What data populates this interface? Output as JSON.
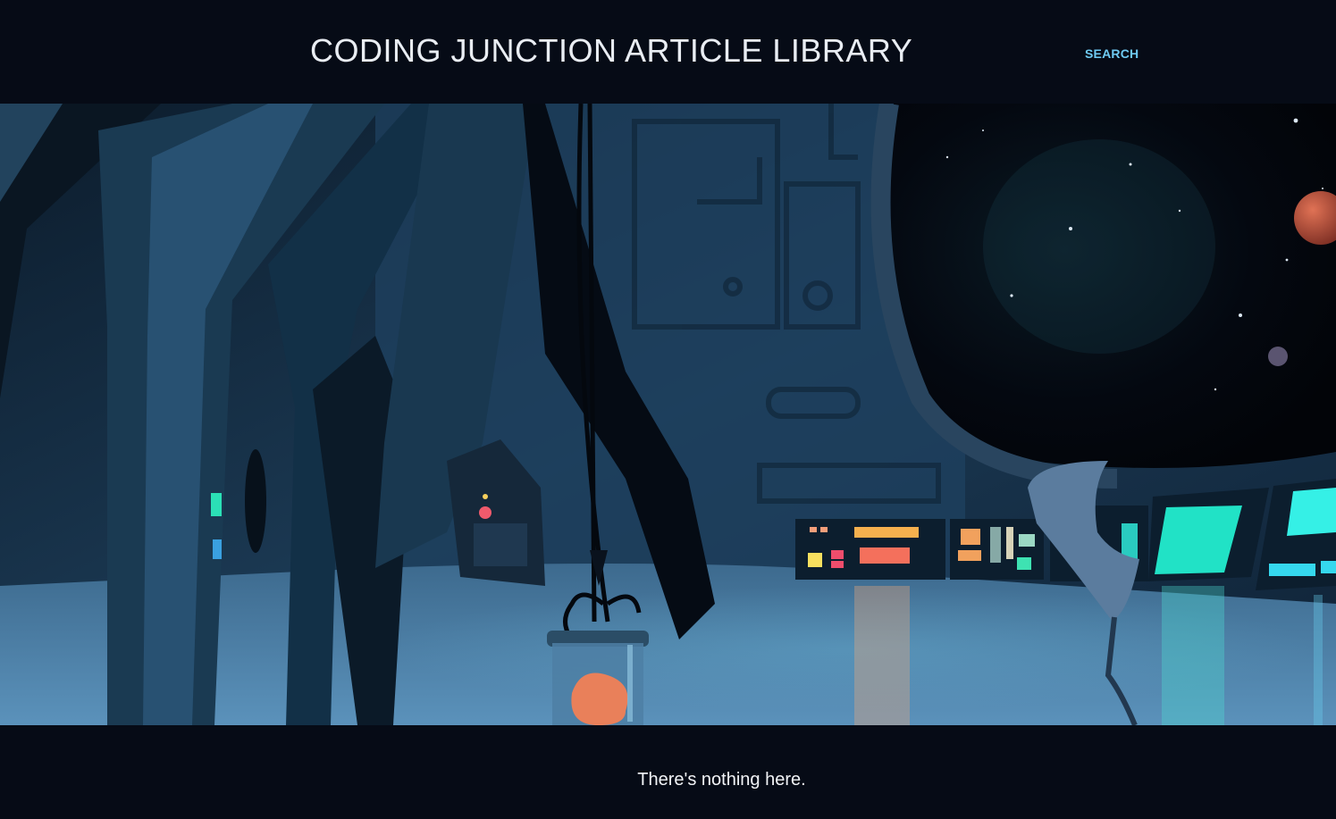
{
  "header": {
    "title": "CODING JUNCTION ARTICLE LIBRARY",
    "search_label": "SEARCH"
  },
  "hero": {
    "image_description_icon": "spaceship-interior-illustration",
    "colors": {
      "wall_dark": "#0f2234",
      "wall_mid": "#1d3a55",
      "floor": "#4f82a8",
      "space": "#03060d",
      "panel_teal": "#27e4c9",
      "panel_orange": "#f58f5c",
      "planet_red": "#c2553f"
    }
  },
  "main": {
    "empty_message": "There's nothing here."
  },
  "theme": {
    "background": "#060b16",
    "title_color": "#e9edf3",
    "link_color": "#6ecaf2"
  }
}
